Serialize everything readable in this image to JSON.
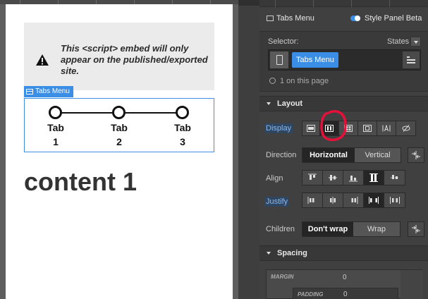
{
  "canvas": {
    "embed_notice": "This <script> embed will only appear on the published/exported site.",
    "tabs_tag": "Tabs Menu",
    "tabs": [
      {
        "word": "Tab",
        "num": "1"
      },
      {
        "word": "Tab",
        "num": "2"
      },
      {
        "word": "Tab",
        "num": "3"
      }
    ],
    "content_heading": "content 1"
  },
  "panel": {
    "element_name": "Tabs Menu",
    "style_panel_beta": "Style Panel Beta",
    "style_panel_beta_enabled": true,
    "selector_label": "Selector:",
    "states_label": "States",
    "selector_chip": "Tabs Menu",
    "on_page": "1 on this page",
    "layout_title": "Layout",
    "display_label": "Display",
    "display_options": [
      "block-icon",
      "flex-icon",
      "grid-icon",
      "inline-block-icon",
      "inline-icon",
      "none-icon"
    ],
    "display_selected": "flex-icon",
    "direction_label": "Direction",
    "direction_options": [
      "Horizontal",
      "Vertical"
    ],
    "direction_selected": "Horizontal",
    "align_label": "Align",
    "align_options": [
      "align-start-icon",
      "align-center-icon",
      "align-end-icon",
      "align-stretch-icon",
      "align-baseline-icon"
    ],
    "align_selected": "align-stretch-icon",
    "justify_label": "Justify",
    "justify_options": [
      "justify-start-icon",
      "justify-center-icon",
      "justify-end-icon",
      "justify-space-between-icon",
      "justify-space-around-icon"
    ],
    "justify_selected": "justify-space-between-icon",
    "children_label": "Children",
    "children_options": [
      "Don't wrap",
      "Wrap"
    ],
    "children_selected": "Don't wrap",
    "spacing_title": "Spacing",
    "margin_label": "MARGIN",
    "margin_value": "0",
    "padding_label": "PADDING",
    "padding_value": "0",
    "colors": {
      "accent": "#3b8ee6",
      "annotation": "#e8103a"
    }
  }
}
